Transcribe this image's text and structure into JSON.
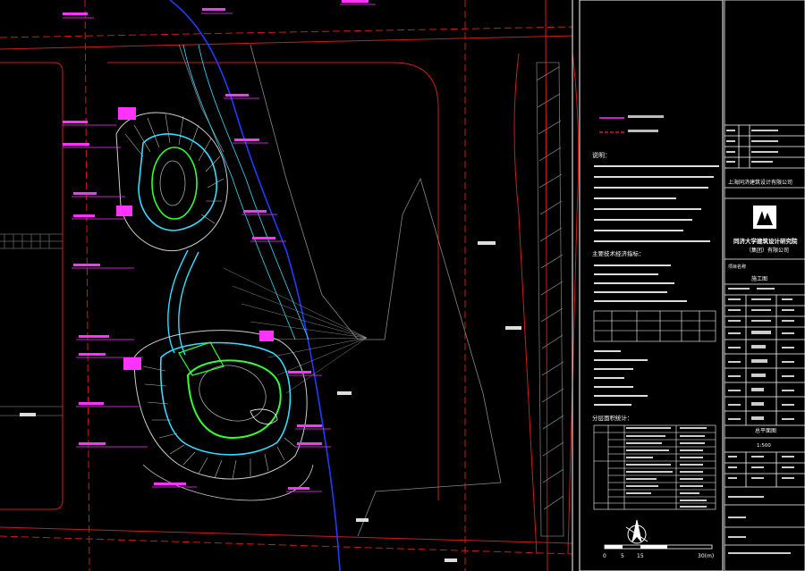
{
  "drawing": {
    "title_block": {
      "company": "上海同济建筑设计有限公司",
      "institute_line1": "同济大学建筑设计研究院",
      "institute_line2": "（集团）有限公司",
      "project_label": "项目名称",
      "drawing_name": "总平面图",
      "scale_label": "1:500",
      "drawing_stage": "施工图"
    },
    "notes": {
      "heading": "说明：",
      "items": [
        "1. 本图尺寸单位除标高以米计外，其余均以毫米计。",
        "2. 建筑定位坐标见总图。",
        "3. 室外地坪标高详见竖向设计。",
        "4. 道路坡度详见道路设计图。",
        "5. 绿化范围以景观设计为准。",
        "6. 消防车道宽度不小于4米。",
        "7. 场地排水详见给排水设计。",
        "8. 图中未尽事宜按有关规范执行。"
      ],
      "tech_heading": "主要技术经济指标：",
      "table_heading": "分层面积统计："
    },
    "scale_bar": {
      "ticks": [
        "0",
        "5",
        "15",
        "30(m)"
      ]
    }
  },
  "colors": {
    "background": "#000000",
    "road_red": "#d11a1a",
    "magenta": "#ff33ff",
    "green": "#33ff33",
    "cyan": "#33ddff",
    "blue": "#1f3cff",
    "white": "#ffffff",
    "gray": "#888888"
  }
}
